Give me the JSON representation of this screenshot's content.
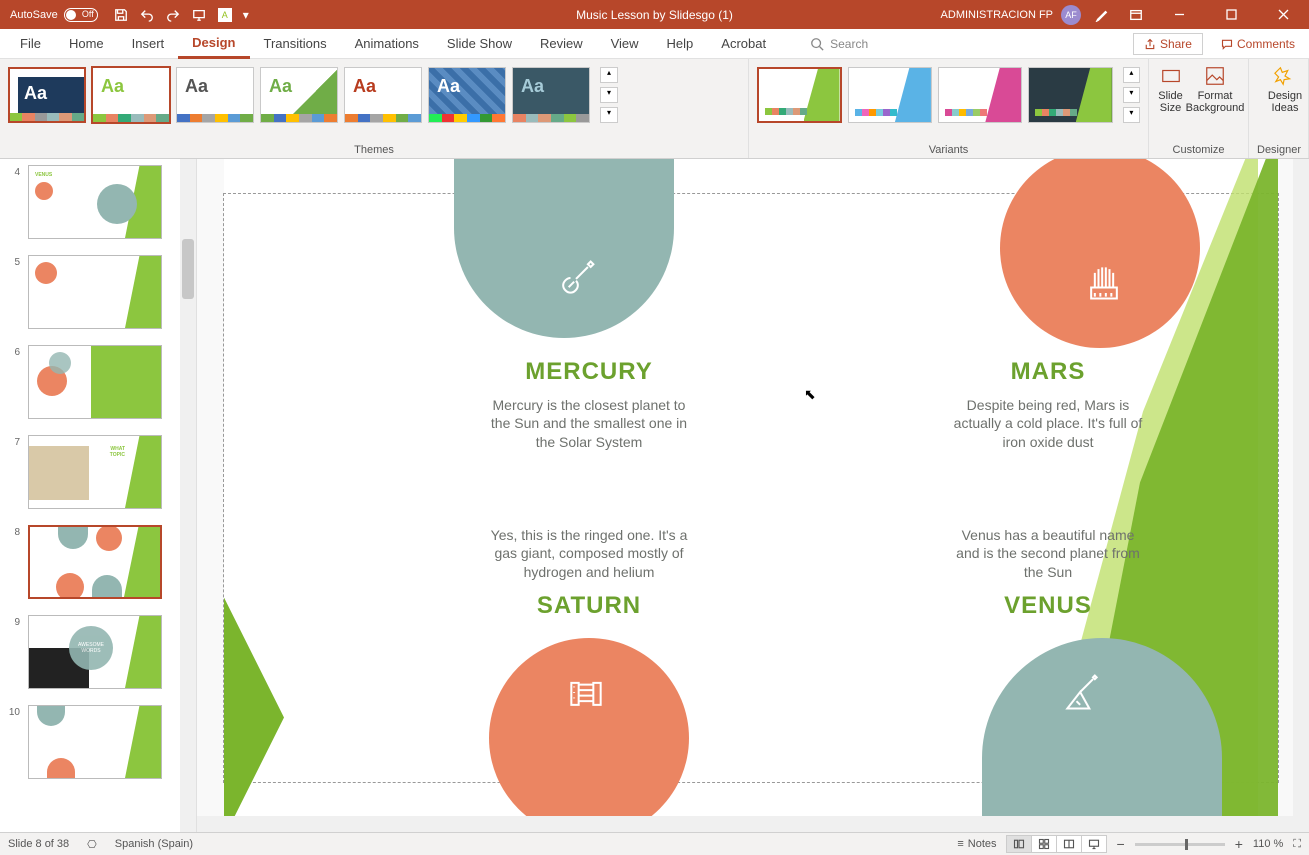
{
  "titlebar": {
    "autosave_label": "AutoSave",
    "autosave_state": "Off",
    "document_title": "Music Lesson by Slidesgo (1)",
    "user_name": "ADMINISTRACION FP",
    "user_initials": "AF"
  },
  "menu": {
    "items": [
      "File",
      "Home",
      "Insert",
      "Design",
      "Transitions",
      "Animations",
      "Slide Show",
      "Review",
      "View",
      "Help",
      "Acrobat"
    ],
    "active": "Design",
    "search_placeholder": "Search",
    "share_label": "Share",
    "comments_label": "Comments"
  },
  "ribbon": {
    "themes_label": "Themes",
    "variants_label": "Variants",
    "customize_label": "Customize",
    "designer_label": "Designer",
    "slide_size_label": "Slide Size",
    "format_bg_label": "Format Background",
    "design_ideas_label": "Design Ideas"
  },
  "thumbnails": {
    "visible": [
      4,
      5,
      6,
      7,
      8,
      9,
      10
    ],
    "selected": 8
  },
  "slide": {
    "mercury": {
      "title": "MERCURY",
      "text": "Mercury is the closest planet to the Sun and the smallest one in the Solar System"
    },
    "mars": {
      "title": "MARS",
      "text": "Despite being red, Mars is actually a cold place. It's full of iron oxide dust"
    },
    "saturn": {
      "title": "SATURN",
      "text": "Yes, this is the ringed one. It's a gas giant, composed mostly of hydrogen and helium"
    },
    "venus": {
      "title": "VENUS",
      "text": "Venus has a beautiful name and is the second planet from the Sun"
    }
  },
  "statusbar": {
    "slide_count": "Slide 8 of 38",
    "language": "Spanish (Spain)",
    "notes_label": "Notes",
    "zoom_percent": "110 %"
  }
}
